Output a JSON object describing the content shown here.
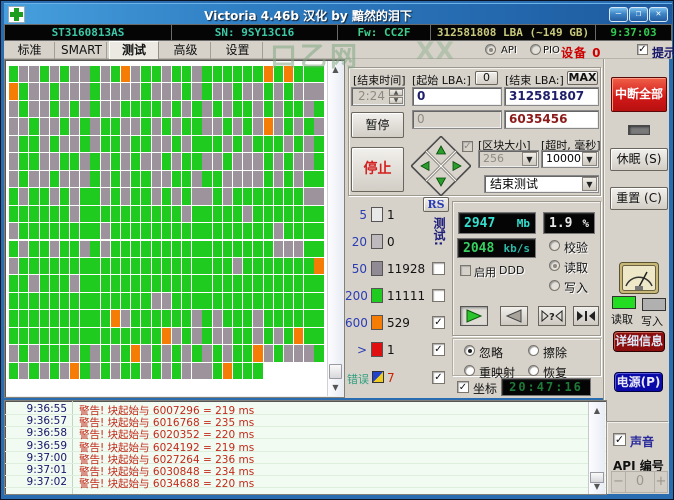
{
  "window": {
    "title": "Victoria 4.46b 汉化 by 黯然的泪下",
    "minimize_glyph": "—",
    "maximize_glyph": "❐",
    "close_glyph": "✕"
  },
  "info_bar": {
    "model": "ST3160813AS",
    "serial": "SN: 9SY13C16",
    "firmware": "Fw: CC2F",
    "capacity": "312581808 LBA (~149 GB)",
    "clock": "9:37:03"
  },
  "tabs": [
    {
      "label": "标准",
      "active": false
    },
    {
      "label": "SMART",
      "active": false
    },
    {
      "label": "测试",
      "active": true
    },
    {
      "label": "高级",
      "active": false
    },
    {
      "label": "设置",
      "active": false
    }
  ],
  "tab_bar": {
    "api_label": "API",
    "pio_label": "PIO",
    "device_label": "设备 0",
    "hint_label": "提示"
  },
  "watermark_text": "口乙网",
  "watermark_text2": "XX",
  "test_controls": {
    "end_time_label": "[结束时间]",
    "end_time_value": "2:24",
    "pause_button": "暂停",
    "stop_button": "停止",
    "start_lba_label": "[起始 LBA:]",
    "start_lba_zero_button": "0",
    "start_lba_value": "0",
    "start_lba_secondary_value": "0",
    "end_lba_label": "[结束 LBA:]",
    "max_button": "MAX",
    "end_lba_value": "312581807",
    "current_lba_value": "6035456",
    "block_size_label": "[区块大小]",
    "block_size_value": "256",
    "timeout_label": "[超时, 毫秒]",
    "timeout_value": "10000",
    "after_action_value": "结束测试",
    "rs_button": "RS",
    "vertical_label": "测试:"
  },
  "legend": {
    "rows": [
      {
        "label": "5",
        "color": "#e8e8e8",
        "count": "1",
        "checkbox": null
      },
      {
        "label": "20",
        "color": "#bdb9bd",
        "count": "0",
        "checkbox": null
      },
      {
        "label": "50",
        "color": "#8f8a93",
        "count": "11928",
        "checkbox": false
      },
      {
        "label": "200",
        "color": "#1ecb1e",
        "count": "11111",
        "checkbox": false
      },
      {
        "label": "600",
        "color": "#f57d05",
        "count": "529",
        "checkbox": true
      },
      {
        "label": ">",
        "color": "#e01010",
        "count": "1",
        "checkbox": true
      },
      {
        "label": "错误",
        "color": null,
        "count": "7",
        "checkbox": true
      }
    ]
  },
  "displays": {
    "mb_value": "2947",
    "mb_unit": "Mb",
    "percent_value": "1.9",
    "percent_unit": "%",
    "speed_value": "2048",
    "speed_unit": "kb/s",
    "ddd_label": "启用",
    "ddd_label2": "DDD",
    "mode_options": [
      {
        "label": "校验",
        "selected": false
      },
      {
        "label": "读取",
        "selected": true
      },
      {
        "label": "写入",
        "selected": false
      }
    ]
  },
  "defect_actions": [
    {
      "label": "忽略",
      "selected": true
    },
    {
      "label": "擦除",
      "selected": false
    },
    {
      "label": "重映射",
      "selected": false
    },
    {
      "label": "恢复",
      "selected": false
    }
  ],
  "coord": {
    "label": "坐标",
    "clock": "20:47:16"
  },
  "right_column": {
    "abort_button": "中断全部",
    "sleep_button": "休眠 (S)",
    "reset_button": "重置 (C)",
    "read_led_label": "读取",
    "write_led_label": "写入",
    "details_button": "详细信息",
    "power_button": "电源(P)"
  },
  "bottom_right": {
    "sound_label": "声音",
    "api_number_label": "API 编号",
    "minus": "−",
    "value": "0",
    "plus": "+"
  },
  "log": {
    "entries": [
      {
        "time": "9:36:55",
        "message": "警告! 块起始与 6007296 = 219 ms"
      },
      {
        "time": "9:36:57",
        "message": "警告! 块起始与 6016768 = 235 ms"
      },
      {
        "time": "9:36:58",
        "message": "警告! 块起始与 6020352 = 220 ms"
      },
      {
        "time": "9:36:59",
        "message": "警告! 块起始与 6024192 = 219 ms"
      },
      {
        "time": "9:37:00",
        "message": "警告! 块起始与 6027264 = 236 ms"
      },
      {
        "time": "9:37:01",
        "message": "警告! 块起始与 6030848 = 234 ms"
      },
      {
        "time": "9:37:02",
        "message": "警告! 块起始与 6034688 = 220 ms"
      }
    ]
  },
  "chart_data": {
    "type": "heatmap",
    "description": "disk surface scan map, 31 columns x 18 rows, G=green good block, D=gray slow block, O=orange very slow block",
    "cell_colors": {
      "G": "#1ecb1e",
      "D": "#9c939c",
      "O": "#f57d05"
    },
    "rows": [
      "GDDGDGDDGDGODGGDGGDGGGGGGOGOGGG",
      "OGDDGDDDGDDDDGDDDGDGDDGDDGDGDDD",
      "DGDDGDGDGDDGGGGDGDGDGDGGDGDGGDG",
      "DDGDDGDGDGGDDGDGDGGDDGDGDODGDGD",
      "DGGDGDDGDGGDGGDDGDGGGDGDGGGDGDG",
      "DGGDDGGDGDGDGDDGDGGDDGDDDGDGDDG",
      "DGDDGDDDGDGDGGDDGGDGGDDDDGDGDGG",
      "GDGGDGDGGDGDGGDGDGDDGDGGGGGGGDD",
      "GGGGGGDGGGGGGGGGGDGGGGGDGGGGGGG",
      "DGGGGGGGGDGGGGGGGGGGGGGGGGDGGGG",
      "GDGGDGGDGDGGGGGGGGGGGGGGGGDDDGG",
      "DGGGGGGGGGGGGGGGGGGGGGDGGGGGGGO",
      "GGDGGGDGGGGGGGGGGGGGGGGGGGGGGGG",
      "GGGGGGGGGGGGGGDDGGGGGGGGGGGGGGG",
      "GGGGGGGGGGODGGGGGGDGDGGGDGGGGGG",
      "GGGGGGGGGGGGGGGODGDGDDGGDGDGOGG",
      "DGDGGGDGDGDGODGDGDGDGDGGODGDDDG",
      "GDGDGDOGDGDGGDGDGDDDGOGGG"
    ]
  }
}
